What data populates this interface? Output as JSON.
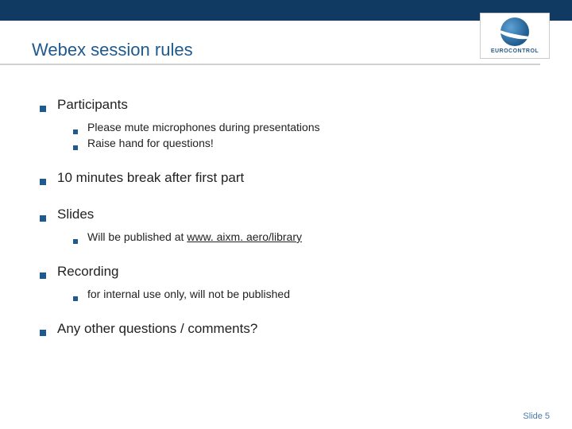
{
  "logo": {
    "brand": "EUROCONTROL"
  },
  "title": "Webex session rules",
  "items": [
    {
      "label": "Participants",
      "sub": [
        {
          "text": "Please mute microphones during presentations"
        },
        {
          "text": "Raise hand for questions!"
        }
      ]
    },
    {
      "label": "10 minutes break after first part",
      "sub": []
    },
    {
      "label": "Slides",
      "sub": [
        {
          "prefix": "Will be published at ",
          "link": "www. aixm. aero/library"
        }
      ]
    },
    {
      "label": "Recording",
      "sub": [
        {
          "text": "for internal use only, will not be published"
        }
      ]
    },
    {
      "label": "Any other questions / comments?",
      "sub": []
    }
  ],
  "footer": {
    "slide_label": "Slide 5"
  }
}
